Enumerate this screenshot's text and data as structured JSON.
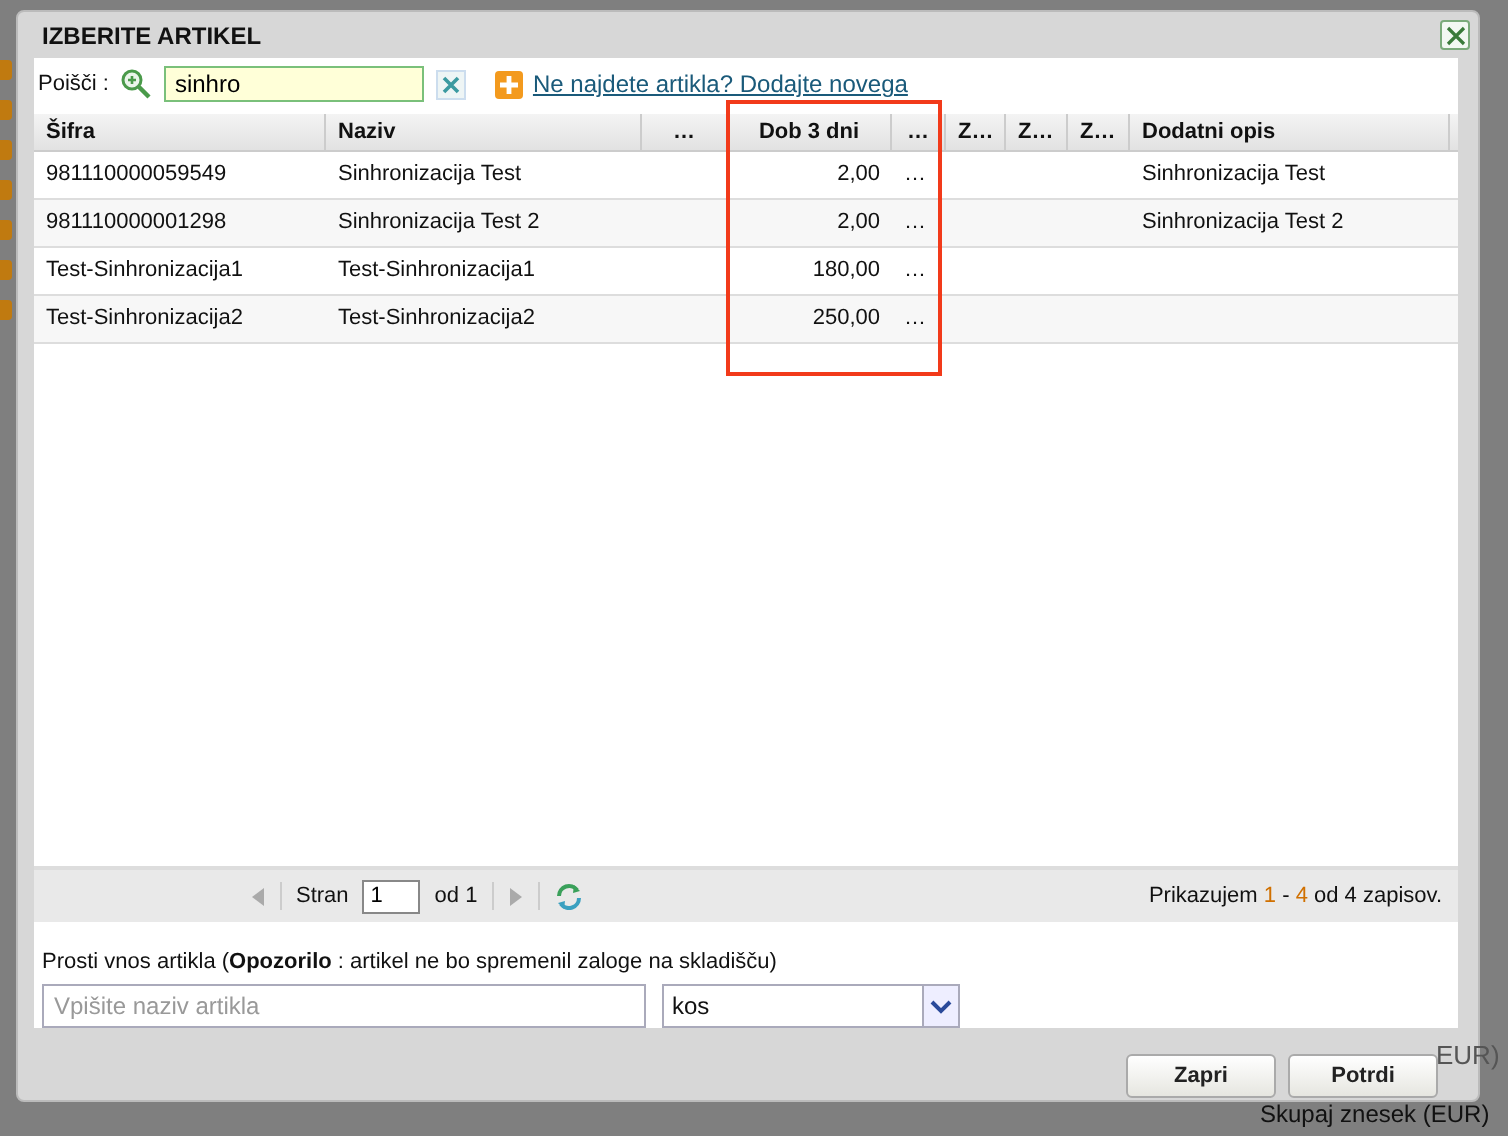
{
  "background": {
    "total_label": "Skupaj znesek (EUR)",
    "partial_label": "EUR)"
  },
  "dialog": {
    "title": "IZBERITE ARTIKEL",
    "search": {
      "label": "Poišči :",
      "value": "sinhro",
      "add_link": "Ne najdete artikla? Dodajte novega"
    },
    "table": {
      "columns": [
        "Šifra",
        "Naziv",
        "…",
        "Dob 3 dni",
        "…",
        "Z…",
        "Z…",
        "Z…",
        "Dodatni opis"
      ],
      "rows": [
        {
          "cells": [
            "981110000059549",
            "Sinhronizacija Test",
            "",
            "2,00",
            "…",
            "",
            "",
            "",
            "Sinhronizacija Test"
          ]
        },
        {
          "cells": [
            "981110000001298",
            "Sinhronizacija Test 2",
            "",
            "2,00",
            "…",
            "",
            "",
            "",
            "Sinhronizacija Test 2"
          ]
        },
        {
          "cells": [
            "Test-Sinhronizacija1",
            "Test-Sinhronizacija1",
            "",
            "180,00",
            "…",
            "",
            "",
            "",
            ""
          ]
        },
        {
          "cells": [
            "Test-Sinhronizacija2",
            "Test-Sinhronizacija2",
            "",
            "250,00",
            "…",
            "",
            "",
            "",
            ""
          ]
        }
      ]
    },
    "pager": {
      "page_label": "Stran",
      "page": "1",
      "of_label": "od 1",
      "summary": "Prikazujem **1** - **4** od 4 zapisov."
    },
    "free_entry": {
      "label": "Prosti vnos artikla (**Opozorilo** : artikel ne bo spremenil zaloge na skladišču)",
      "placeholder": "Vpišite naziv artikla",
      "unit": "kos"
    },
    "buttons": [
      "Zapri",
      "Potrdi"
    ]
  }
}
